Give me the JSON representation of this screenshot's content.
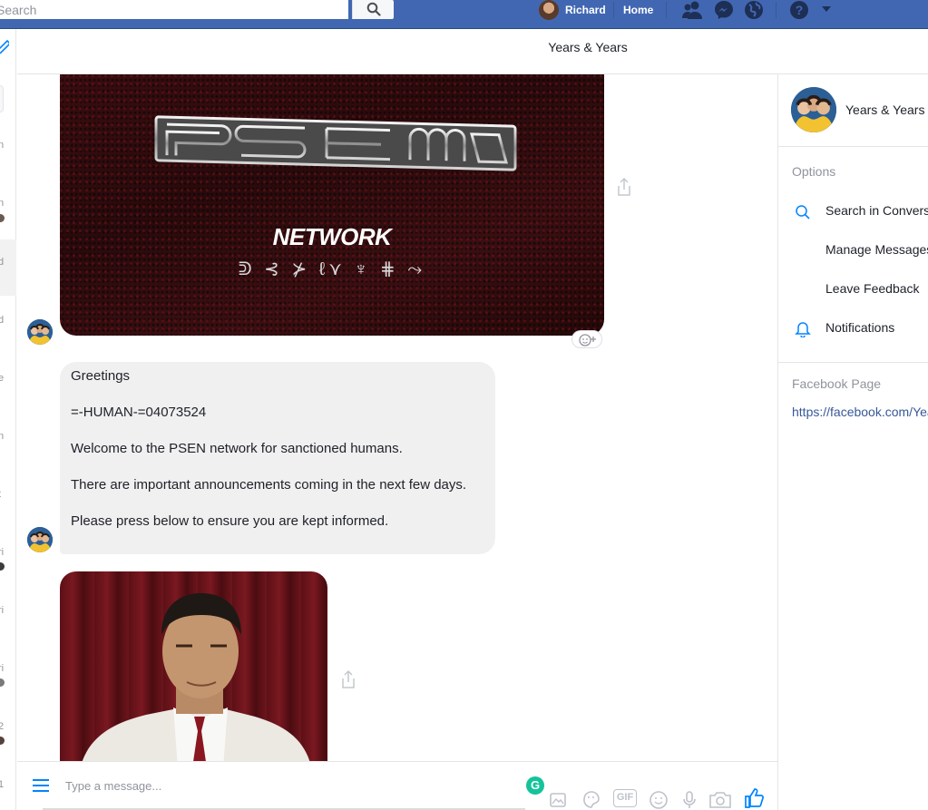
{
  "topbar": {
    "search_placeholder": "Search",
    "user_name": "Richard",
    "home_label": "Home",
    "icons": [
      "search-icon",
      "friends-icon",
      "messenger-icon",
      "globe-icon",
      "help-icon",
      "dropdown-arrow-icon"
    ]
  },
  "sidebar": {
    "compose_icon": "compose-icon",
    "truncated_labels": [
      "n",
      "n",
      "d",
      "d",
      "e",
      "n",
      "t",
      "ri",
      "ri",
      "ri",
      "2",
      "1"
    ]
  },
  "header": {
    "title": "Years & Years"
  },
  "conversation": {
    "image1": {
      "wordmark": "NETWORK",
      "glyphs": "ᕲ ⊰ ⊁ ℓ⋎ ♆ ⋕ ⤳"
    },
    "message": {
      "paragraphs": [
        "Greetings",
        "=-HUMAN-=04073524",
        "Welcome to the PSEN network for sanctioned humans.",
        "There are important announcements coming in the next few days.",
        "Please press below to ensure you are kept informed."
      ]
    }
  },
  "composer": {
    "placeholder": "Type a message...",
    "icons": [
      "menu-icon",
      "grammarly-icon",
      "image-icon",
      "sticker-icon",
      "gif-icon",
      "emoji-icon",
      "microphone-icon",
      "camera-icon",
      "like-icon"
    ],
    "grammarly_letter": "G",
    "gif_label": "GIF"
  },
  "right_panel": {
    "name": "Years & Years",
    "options_title": "Options",
    "options": [
      {
        "label": "Search in Conversation",
        "icon": "search-icon"
      },
      {
        "label": "Manage Messages",
        "icon": ""
      },
      {
        "label": "Leave Feedback",
        "icon": ""
      },
      {
        "label": "Notifications",
        "icon": "bell-icon"
      }
    ],
    "page_title": "Facebook Page",
    "page_link": "https://facebook.com/YearsAndYears"
  },
  "colors": {
    "brand": "#4267b2",
    "link": "#385898",
    "accent": "#0084ff",
    "bubble": "#f1f0f0"
  }
}
